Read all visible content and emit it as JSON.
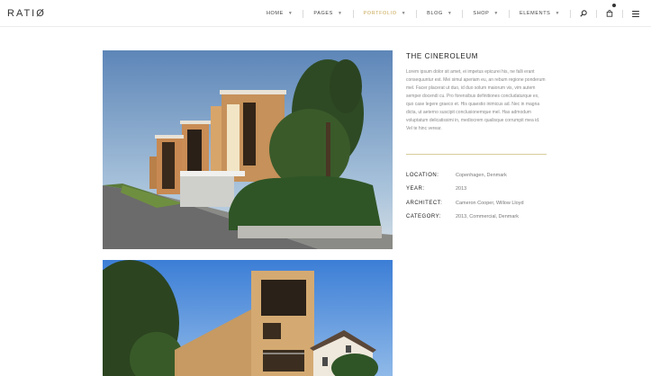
{
  "header": {
    "logo": "RATIØ",
    "nav": [
      {
        "label": "HOME",
        "has_caret": true,
        "active": false
      },
      {
        "label": "PAGES",
        "has_caret": true,
        "active": false
      },
      {
        "label": "PORTFOLIO",
        "has_caret": true,
        "active": true
      },
      {
        "label": "BLOG",
        "has_caret": true,
        "active": false
      },
      {
        "label": "SHOP",
        "has_caret": true,
        "active": false
      },
      {
        "label": "ELEMENTS",
        "has_caret": true,
        "active": false
      }
    ],
    "icons": [
      "search-icon",
      "cart-icon",
      "menu-icon"
    ]
  },
  "project": {
    "title": "THE CINEROLEUM",
    "description": "Lorem ipsum dolor sit amet, ei impetus epicurei his, ne falli erant consequuntur est. Mei simul aperiam eu, an rebum regione ponderum mel. Facer placerat ut duo, id duo solum maiorum vis, vim autem semper docendi cu. Pro forensibus definitiones concludaturque ex, quo case legere graeco et. His quaestio inimicus ad. Nec in magna dicta, ut aeterno suscipit conclusionemque mel. Has admodum voluptatum delicatissimi in, mediocrem qualisque corrumpit mea id. Vel te hinc verear.",
    "meta": [
      {
        "label": "LOCATION:",
        "value": "Copenhagen, Denmark"
      },
      {
        "label": "YEAR:",
        "value": "2013"
      },
      {
        "label": "ARCHITECT:",
        "value": "Cameron Cooper, Willow Lloyd"
      },
      {
        "label": "CATEGORY:",
        "value": "2013, Commercial, Denmark"
      }
    ]
  },
  "colors": {
    "accent": "#c9a957",
    "text_dark": "#222222",
    "text_muted": "#888888"
  }
}
